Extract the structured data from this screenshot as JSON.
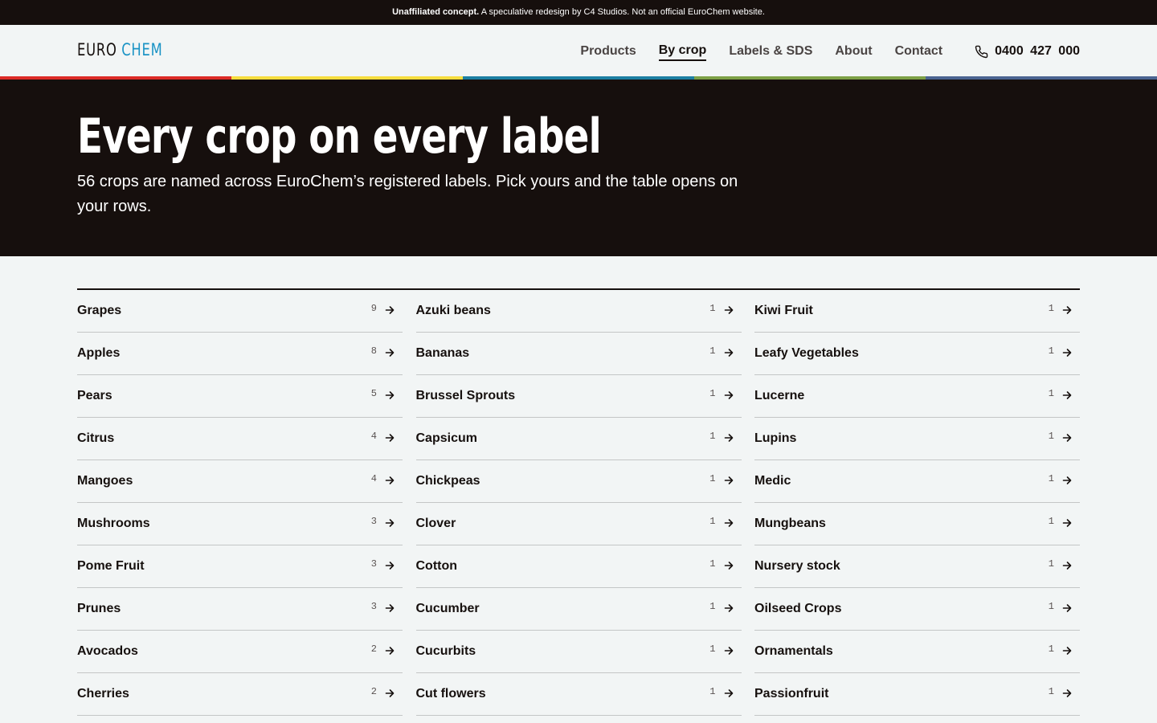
{
  "notice": {
    "bold": "Unaffiliated concept.",
    "text": " A speculative redesign by C4 Studios. Not an official EuroChem website."
  },
  "brand": {
    "part1": "EURO",
    "part2": "CHEM"
  },
  "nav": {
    "items": [
      {
        "label": "Products",
        "active": false
      },
      {
        "label": "By crop",
        "active": true
      },
      {
        "label": "Labels & SDS",
        "active": false
      },
      {
        "label": "About",
        "active": false
      },
      {
        "label": "Contact",
        "active": false
      }
    ],
    "phone": "0400 427 000"
  },
  "stripe_colors": [
    "#dc2b27",
    "#f7dd3e",
    "#1d7fa2",
    "#7da046",
    "#4b6491"
  ],
  "hero": {
    "title": "Every crop on every label",
    "subtitle": "56 crops are named across EuroChem’s registered labels. Pick yours and the table opens on your rows."
  },
  "crops": {
    "columns": [
      [
        {
          "name": "Grapes",
          "count": "9"
        },
        {
          "name": "Apples",
          "count": "8"
        },
        {
          "name": "Pears",
          "count": "5"
        },
        {
          "name": "Citrus",
          "count": "4"
        },
        {
          "name": "Mangoes",
          "count": "4"
        },
        {
          "name": "Mushrooms",
          "count": "3"
        },
        {
          "name": "Pome Fruit",
          "count": "3"
        },
        {
          "name": "Prunes",
          "count": "3"
        },
        {
          "name": "Avocados",
          "count": "2"
        },
        {
          "name": "Cherries",
          "count": "2"
        }
      ],
      [
        {
          "name": "Azuki beans",
          "count": "1"
        },
        {
          "name": "Bananas",
          "count": "1"
        },
        {
          "name": "Brussel Sprouts",
          "count": "1"
        },
        {
          "name": "Capsicum",
          "count": "1"
        },
        {
          "name": "Chickpeas",
          "count": "1"
        },
        {
          "name": "Clover",
          "count": "1"
        },
        {
          "name": "Cotton",
          "count": "1"
        },
        {
          "name": "Cucumber",
          "count": "1"
        },
        {
          "name": "Cucurbits",
          "count": "1"
        },
        {
          "name": "Cut flowers",
          "count": "1"
        }
      ],
      [
        {
          "name": "Kiwi Fruit",
          "count": "1"
        },
        {
          "name": "Leafy Vegetables",
          "count": "1"
        },
        {
          "name": "Lucerne",
          "count": "1"
        },
        {
          "name": "Lupins",
          "count": "1"
        },
        {
          "name": "Medic",
          "count": "1"
        },
        {
          "name": "Mungbeans",
          "count": "1"
        },
        {
          "name": "Nursery stock",
          "count": "1"
        },
        {
          "name": "Oilseed Crops",
          "count": "1"
        },
        {
          "name": "Ornamentals",
          "count": "1"
        },
        {
          "name": "Passionfruit",
          "count": "1"
        }
      ]
    ]
  }
}
